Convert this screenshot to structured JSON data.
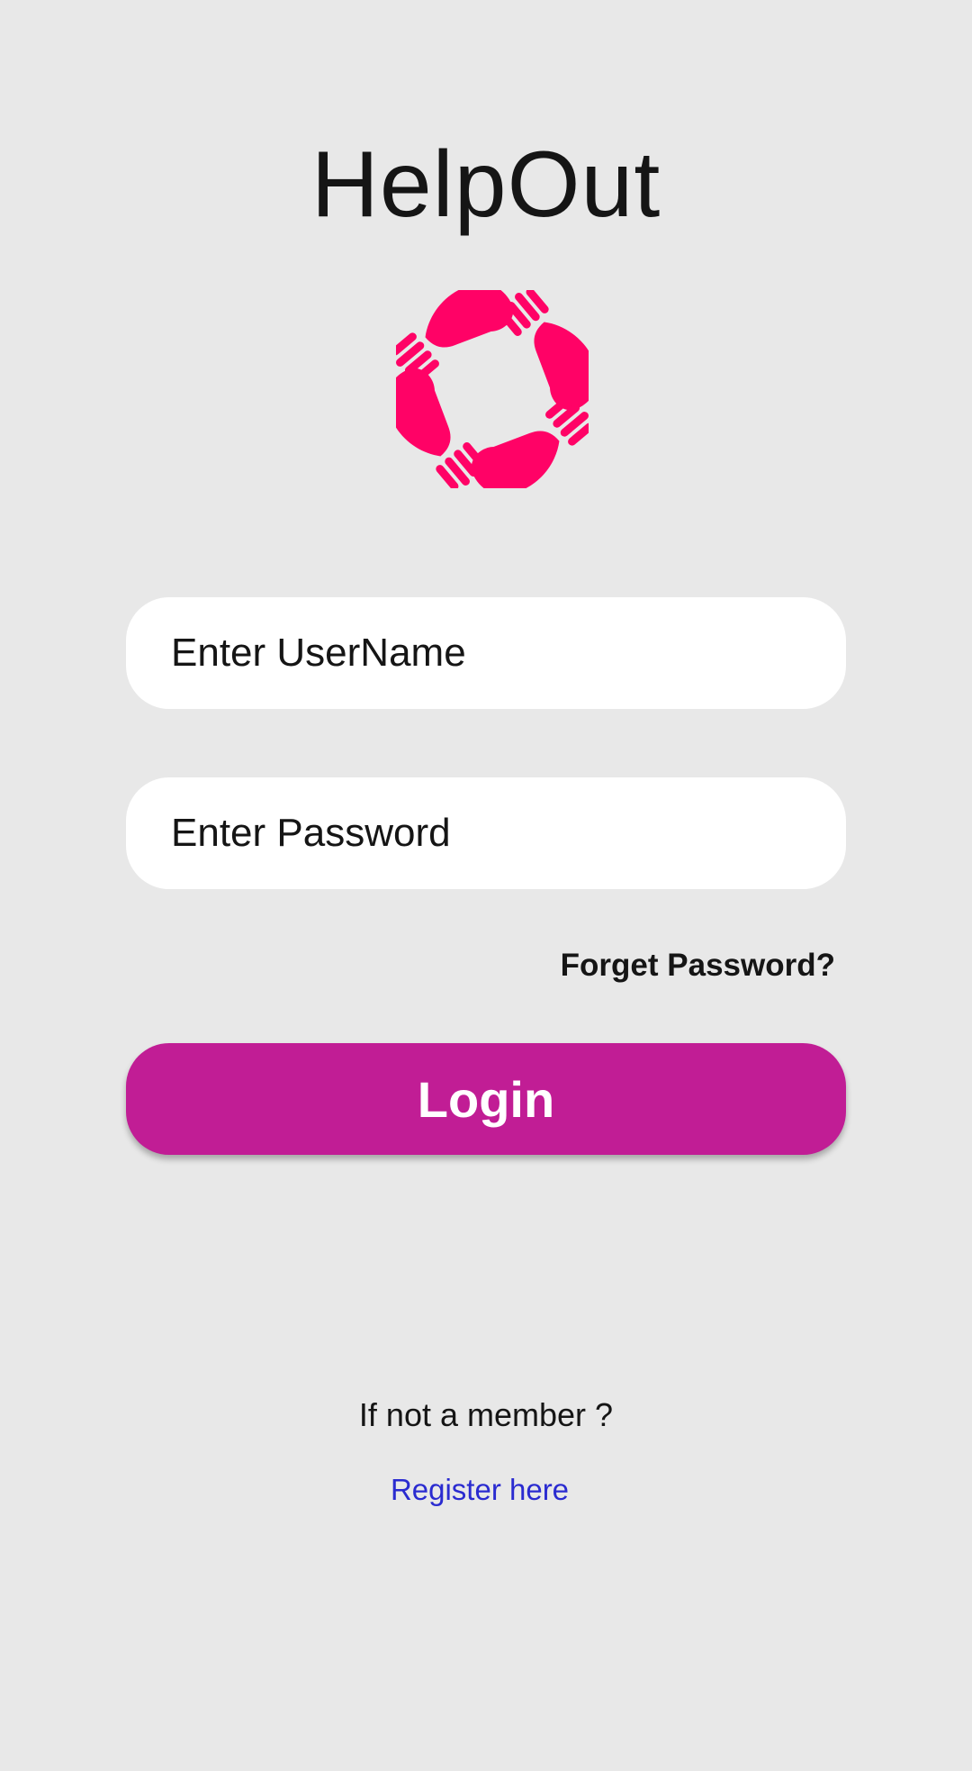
{
  "app": {
    "title": "HelpOut",
    "brand_color": "#c11d95",
    "logo_color": "#ff0266",
    "logo_icon": "helping-hands-icon"
  },
  "form": {
    "username_placeholder": "Enter UserName",
    "password_placeholder": "Enter Password",
    "forgot_label": "Forget Password?",
    "login_label": "Login"
  },
  "footer": {
    "member_text": "If not a member ?",
    "register_label": "Register here",
    "register_color": "#2a2bd0"
  }
}
